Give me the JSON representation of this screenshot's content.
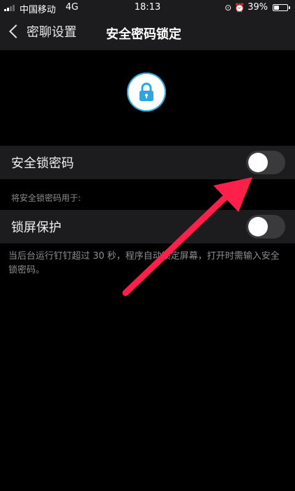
{
  "status_bar": {
    "carrier": "中国移动",
    "network": "4G",
    "time": "18:13",
    "battery": "39%"
  },
  "nav": {
    "back_label": "密聊设置",
    "title": "安全密码锁定"
  },
  "settings": {
    "security_lock": {
      "label": "安全锁密码",
      "enabled": false
    },
    "used_for_note": "将安全锁密码用于:",
    "screen_lock": {
      "label": "锁屏保护",
      "enabled": false
    },
    "description": "当后台运行钉钉超过 30 秒，程序自动锁定屏幕，打开时需输入安全锁密码。"
  },
  "colors": {
    "background": "#000000",
    "row_background": "#1c1c1e",
    "accent_blue": "#2ba6e1",
    "arrow": "#ff1f4b",
    "note_text": "#8e8e93"
  }
}
